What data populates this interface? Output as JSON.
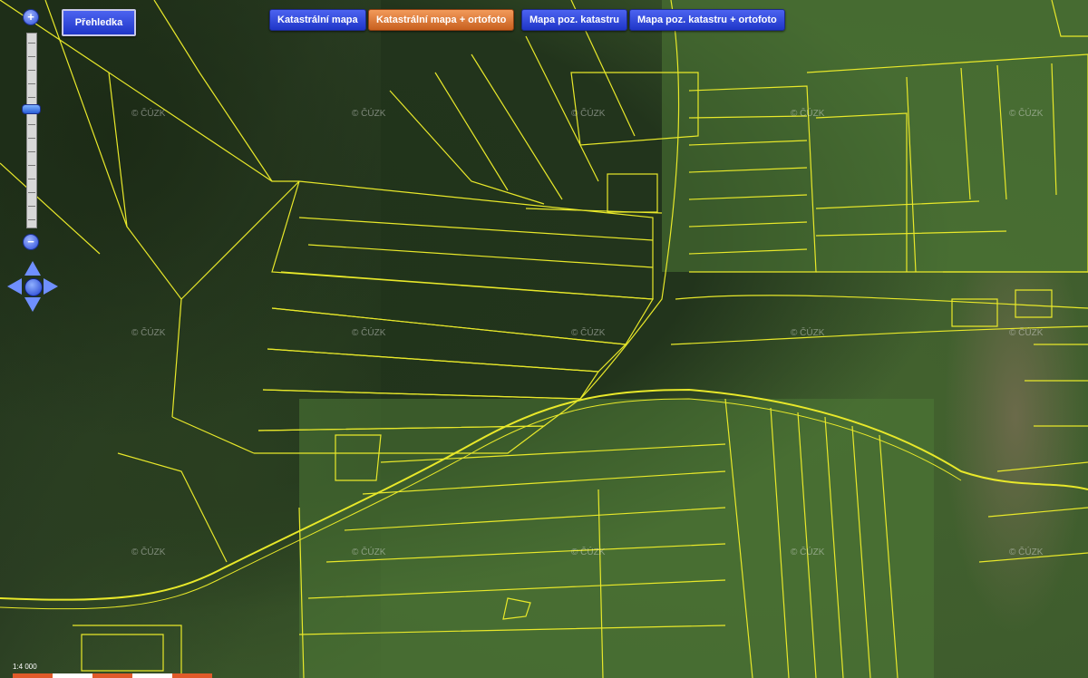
{
  "toolbar": {
    "overview_label": "Přehledka",
    "layers": [
      {
        "label": "Katastrální mapa",
        "active": false
      },
      {
        "label": "Katastrální mapa + ortofoto",
        "active": true
      },
      {
        "label": "Mapa poz. katastru",
        "active": false
      },
      {
        "label": "Mapa poz. katastru + ortofoto",
        "active": false
      }
    ]
  },
  "zoom": {
    "in_label": "+",
    "out_label": "−",
    "level_fraction": 0.37
  },
  "watermark": "© ČÚZK",
  "scale": {
    "label": "1:4 000"
  },
  "colors": {
    "parcel_line": "#e8e82a",
    "active_button": "#e07a3a",
    "button": "#2a44d8"
  }
}
